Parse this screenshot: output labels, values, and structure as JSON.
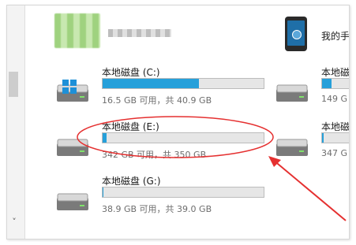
{
  "header": {
    "phone_label": "我的手"
  },
  "drives": [
    {
      "label": "本地磁盘 (C:)",
      "info": "16.5 GB 可用，共 40.9 GB",
      "used_fraction": 0.597,
      "os_drive": true
    },
    {
      "label": "本地磁盘 (E:)",
      "info": "342 GB 可用，共 350 GB",
      "used_fraction": 0.023,
      "os_drive": false
    },
    {
      "label": "本地磁盘 (G:)",
      "info": "38.9 GB 可用，共 39.0 GB",
      "used_fraction": 0.003,
      "os_drive": false
    }
  ],
  "right_drives": [
    {
      "label": "本地磁",
      "info": "149 G",
      "used_fraction": 0.2
    },
    {
      "label": "本地磁",
      "info": "347 G",
      "used_fraction": 0.04
    }
  ],
  "colors": {
    "bar_fill": "#26a0da",
    "annotation_red": "#e53030"
  }
}
